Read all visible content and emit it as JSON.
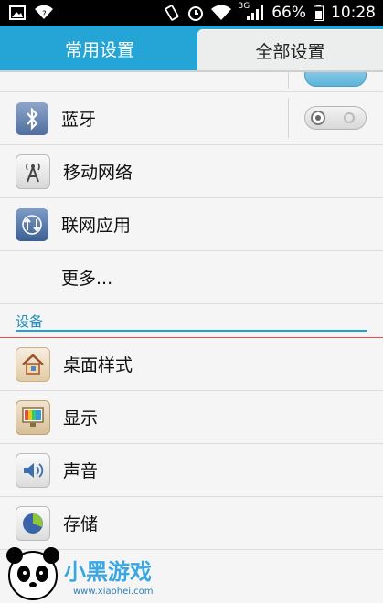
{
  "statusbar": {
    "network_type": "3G",
    "battery": "66%",
    "time": "10:28"
  },
  "tabs": {
    "common": "常用设置",
    "all": "全部设置"
  },
  "list": {
    "bluetooth": "蓝牙",
    "mobile_network": "移动网络",
    "connected_apps": "联网应用",
    "more": "更多..."
  },
  "section": {
    "device": "设备"
  },
  "device_items": {
    "desktop_style": "桌面样式",
    "display": "显示",
    "sound": "声音",
    "storage": "存储"
  },
  "watermark": {
    "brand": "小黑游戏",
    "url": "www.xiaohei.com"
  },
  "colors": {
    "accent": "#25a4d6",
    "section_title": "#1e8fc0",
    "divider_red": "#d9534f"
  }
}
